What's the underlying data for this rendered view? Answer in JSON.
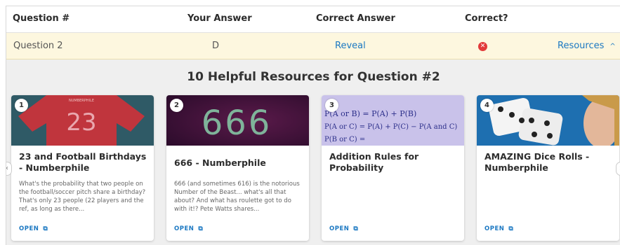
{
  "table": {
    "headers": {
      "question": "Question #",
      "your_answer": "Your Answer",
      "correct_answer": "Correct Answer",
      "correct": "Correct?"
    },
    "row": {
      "question": "Question 2",
      "your_answer": "D",
      "reveal_label": "Reveal",
      "correct_icon": "x-circle-icon",
      "resources_label": "Resources",
      "resources_icon": "chevron-up-icon"
    }
  },
  "resources": {
    "title": "10 Helpful Resources for Question #2",
    "cards": [
      {
        "number": "1",
        "title": "23 and Football Birthdays - Numberphile",
        "description": "What's the probability that two people on the football/soccer pitch share a birthday? That's only 23 people (22 players and the ref, as long as there...",
        "thumb_text": "23",
        "open_label": "OPEN"
      },
      {
        "number": "2",
        "title": "666 - Numberphile",
        "description": "666 (and sometimes 616) is the notorious Number of the Beast... what's all that about? And what has roulette got to do with it!? Pete Watts shares...",
        "thumb_text": "666",
        "open_label": "OPEN"
      },
      {
        "number": "3",
        "title": "Addition Rules for Probability",
        "description": "",
        "thumb_text": "P(A or B) = P(A) + P(B)",
        "open_label": "OPEN"
      },
      {
        "number": "4",
        "title": "AMAZING Dice Rolls - Numberphile",
        "description": "",
        "thumb_text": "",
        "open_label": "OPEN"
      }
    ]
  },
  "colors": {
    "link": "#1b78c2",
    "highlight_row": "#fdf7df",
    "wrong": "#e23a3a",
    "panel": "#efefef"
  }
}
